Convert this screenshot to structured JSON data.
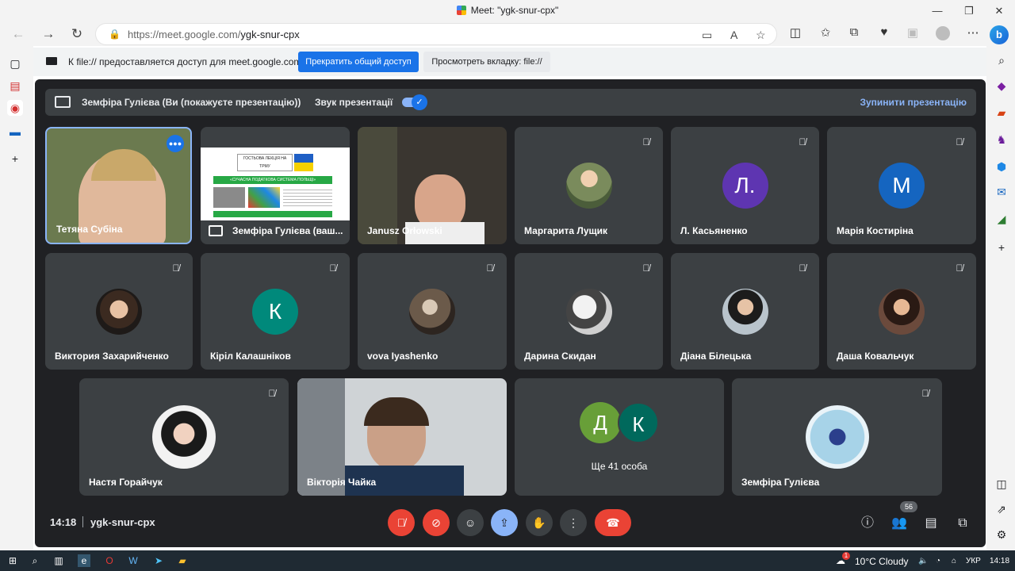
{
  "window": {
    "title": "Meet: \"ygk-snur-cpx\"",
    "minimize": "—",
    "maximize": "❐",
    "close": "✕"
  },
  "nav": {
    "back": "←",
    "forward": "→",
    "reload": "↻",
    "url_prefix": "https://meet.google.com/",
    "url_path": "ygk-snur-cpx"
  },
  "share_notice": {
    "message": "К file:// предоставляется доступ для meet.google.com",
    "stop_label": "Прекратить общий доступ",
    "view_label": "Просмотреть вкладку: file://"
  },
  "presentation_bar": {
    "presenter_text": "Земфіра Гулієва (Ви (покажуєте презентацію))",
    "sound_label": "Звук презентації",
    "stop_label": "Зупинити презентацію"
  },
  "tiles": [
    {
      "name": "Тетяна Субіна"
    },
    {
      "name": "Земфіра Гулієва (ваш..."
    },
    {
      "name": "Janusz Orłowski"
    },
    {
      "name": "Маргарита Лущик"
    },
    {
      "name": "Л. Касьяненко",
      "letter": "Л.",
      "color": "#5e35b1"
    },
    {
      "name": "Марія Костиріна",
      "letter": "М",
      "color": "#1565c0"
    },
    {
      "name": "Виктория Захарийченко"
    },
    {
      "name": "Кірiл Калашніков",
      "letter": "К",
      "color": "#00897b"
    },
    {
      "name": "vova Iyashenko"
    },
    {
      "name": "Дарина Скидан"
    },
    {
      "name": "Діана Білецька"
    },
    {
      "name": "Даша Ковальчук"
    },
    {
      "name": "Настя Горайчук"
    },
    {
      "name": "Вікторія Чайка"
    },
    {
      "name": "Земфіра Гулієва"
    }
  ],
  "slide": {
    "title": "ГОСТЬОВА ЛЕКЦІЯ НА ТРМУ",
    "subtitle": "«СУЧАСНА ПОДАТКОВА СИСТЕМА ПОЛЬЩІ»"
  },
  "multi": {
    "letter1": "Д",
    "letter2": "К",
    "more_label": "Ще 41 особа"
  },
  "controls": {
    "time": "14:18",
    "meeting_code": "ygk-snur-cpx",
    "participants_count": "56"
  },
  "taskbar": {
    "weather": "10°C  Cloudy",
    "lang": "УКР",
    "clock": "14:18",
    "notification_count": "1"
  }
}
